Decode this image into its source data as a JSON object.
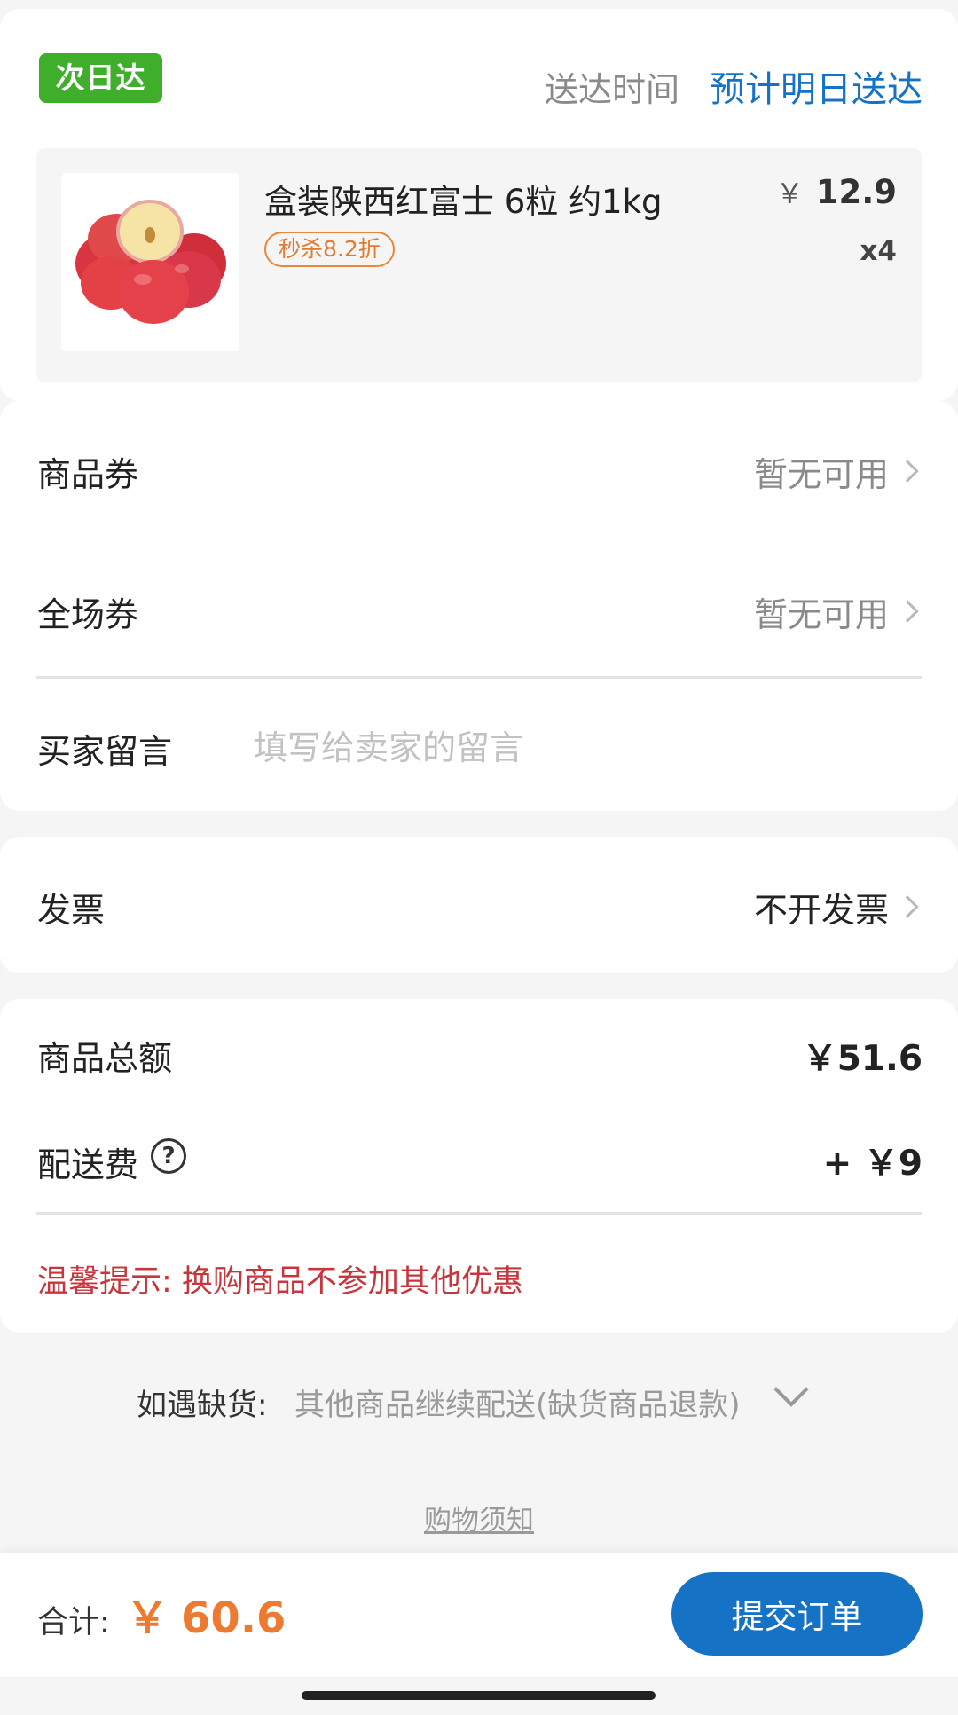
{
  "delivery": {
    "badge": "次日达",
    "label": "送达时间",
    "value": "预计明日送达",
    "badge_color": "#3fae2a",
    "accent_color": "#1672c5"
  },
  "product": {
    "image_icon": "apple-product-image",
    "name": "盒装陕西红富士 6粒 约1kg",
    "promo_tag": "秒杀8.2折",
    "price_symbol": "￥",
    "price": "12.9",
    "quantity": "x4"
  },
  "coupons": {
    "goods_coupon_label": "商品券",
    "goods_coupon_value": "暂无可用",
    "store_coupon_label": "全场券",
    "store_coupon_value": "暂无可用"
  },
  "message": {
    "label": "买家留言",
    "placeholder": "填写给卖家的留言",
    "value": ""
  },
  "invoice": {
    "label": "发票",
    "value": "不开发票"
  },
  "summary": {
    "goods_total_label": "商品总额",
    "goods_total_value": "￥51.6",
    "shipping_label": "配送费",
    "shipping_value": "+ ￥9",
    "tip": "温馨提示: 换购商品不参加其他优惠",
    "tip_color": "#c9353d"
  },
  "stockout": {
    "label": "如遇缺货:",
    "value": "其他商品继续配送(缺货商品退款)"
  },
  "notice_link": "购物须知",
  "footer": {
    "total_label": "合计:",
    "total_symbol": "￥",
    "total_value": "60.6",
    "total_color": "#ec7a30",
    "submit_label": "提交订单"
  }
}
